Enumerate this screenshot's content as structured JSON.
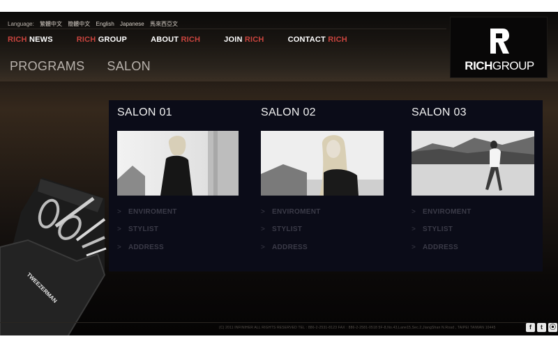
{
  "language": {
    "label": "Language:",
    "options": [
      "繁體中文",
      "簡體中文",
      "English",
      "Japanese",
      "馬來西亞文"
    ]
  },
  "topnav": [
    {
      "prefix": "RICH",
      "suffix": " NEWS"
    },
    {
      "prefix": "RICH",
      "suffix": " GROUP"
    },
    {
      "prefix": "ABOUT ",
      "suffix": "RICH"
    },
    {
      "prefix": "JOIN ",
      "suffix": "RICH"
    },
    {
      "prefix": "CONTACT ",
      "suffix": "RICH"
    }
  ],
  "subnav": [
    "PROGRAMS",
    "SALON"
  ],
  "logo": {
    "bold": "RICH",
    "regular": "GROUP"
  },
  "salons": [
    {
      "title": "SALON 01",
      "links": [
        "ENVIROMENT",
        "STYLIST",
        "ADDRESS"
      ]
    },
    {
      "title": "SALON 02",
      "links": [
        "ENVIROMENT",
        "STYLIST",
        "ADDRESS"
      ]
    },
    {
      "title": "SALON 03",
      "links": [
        "ENVIROMENT",
        "STYLIST",
        "ADDRESS"
      ]
    }
  ],
  "product": {
    "brand": "TWEEZERMAN"
  },
  "footer": {
    "text": "(C) 2011 INFINIHER ALL RIGHTS RESERVED          TEL : 886-2-2531-8123    FAX : 886-2-2581-0518          5F-8,No.43,Lane15,Sec.2,JiangShan N.Road , TAIPEI TAIWAN 10445"
  },
  "social": [
    {
      "icon": "facebook-icon",
      "glyph": "f"
    },
    {
      "icon": "twitter-icon",
      "glyph": "t"
    },
    {
      "icon": "rss-icon",
      "glyph": "⦿"
    }
  ],
  "colors": {
    "accent": "#c9443e",
    "panel": "#0b0c18",
    "link": "#3b3b48"
  }
}
